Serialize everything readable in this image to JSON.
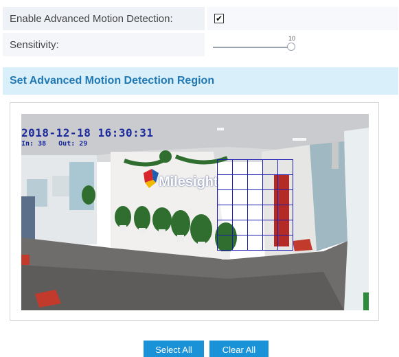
{
  "motion": {
    "enable_label": "Enable Advanced Motion Detection:",
    "enable_checked": true,
    "enable_glyph": "✔",
    "sensitivity_label": "Sensitivity:",
    "sensitivity_value": "10",
    "sensitivity_level": 1.0
  },
  "region": {
    "title": "Set Advanced Motion Detection Region",
    "osd_time": "2018-12-18  16:30:31",
    "osd_in": "In: 38",
    "osd_out": "Out: 29",
    "logo_text": "Milesight"
  },
  "buttons": {
    "select_all": "Select All",
    "clear_all": "Clear All"
  },
  "colors": {
    "accent": "#1a92d8",
    "header_bg": "#d9effa",
    "header_text": "#1f78b4",
    "grid_line": "#1a1ab5"
  },
  "icons": {
    "checkbox": "check-icon",
    "logo": "milesight-logo-icon"
  }
}
